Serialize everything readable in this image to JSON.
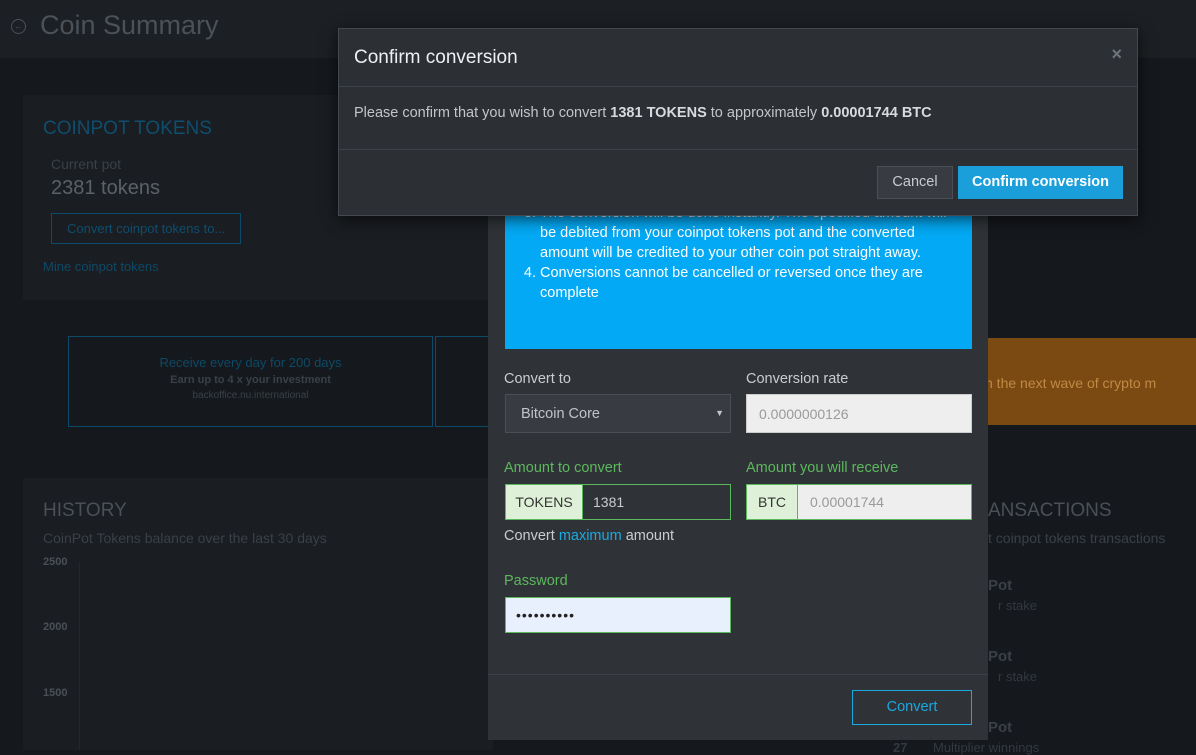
{
  "page": {
    "title": "Coin Summary"
  },
  "tokens_panel": {
    "title": "COINPOT TOKENS",
    "current_pot_label": "Current pot",
    "current_pot_value": "2381 tokens",
    "convert_button": "Convert coinpot tokens to...",
    "mine_link": "Mine coinpot tokens"
  },
  "ad": {
    "line1": "Receive every day for 200 days",
    "line2": "Earn up to 4 x your investment",
    "line3": "backoffice.nu.international",
    "orange_text": "n the next wave of crypto m"
  },
  "history": {
    "title": "HISTORY",
    "subtitle": "CoinPot Tokens balance over the last 30 days",
    "y_ticks": [
      "2500",
      "2000",
      "1500"
    ]
  },
  "transactions": {
    "title": "ANSACTIONS",
    "subtitle": "t coinpot tokens transactions",
    "items": [
      {
        "name": "Pot",
        "desc": "r stake"
      },
      {
        "name": "Pot",
        "desc": "r stake"
      },
      {
        "name": "Pot",
        "desc": "Multiplier winnings",
        "num": "27"
      }
    ]
  },
  "convert_modal": {
    "info_items": [
      "The conversion will be done instantly. The specified amount will be debited from your coinpot tokens pot and the converted amount will be credited to your other coin pot straight away.",
      "Conversions cannot be cancelled or reversed once they are complete"
    ],
    "convert_to_label": "Convert to",
    "convert_to_value": "Bitcoin Core",
    "rate_label": "Conversion rate",
    "rate_value": "0.0000000126",
    "amount_label": "Amount to convert",
    "amount_addon": "TOKENS",
    "amount_value": "1381",
    "receive_label": "Amount you will receive",
    "receive_addon": "BTC",
    "receive_value": "0.00001744",
    "max_prefix": "Convert",
    "max_link": "maximum",
    "max_suffix": "amount",
    "password_label": "Password",
    "password_value": "••••••••••",
    "convert_button": "Convert"
  },
  "confirm_dialog": {
    "title": "Confirm conversion",
    "close": "×",
    "msg_prefix": "Please confirm that you wish to convert",
    "msg_tokens": "1381 TOKENS",
    "msg_mid": "to approximately",
    "msg_btc": "0.00001744 BTC",
    "cancel": "Cancel",
    "confirm": "Confirm conversion"
  }
}
